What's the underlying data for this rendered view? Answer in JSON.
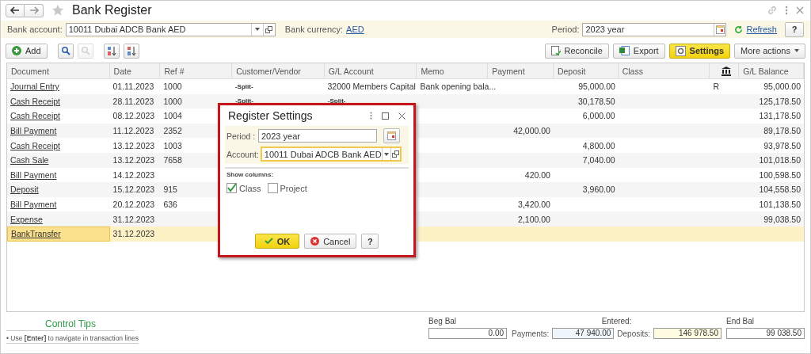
{
  "window": {
    "title": "Bank Register"
  },
  "filters": {
    "bank_account_label": "Bank account:",
    "bank_account": "10011 Dubai ADCB Bank AED",
    "currency_label": "Bank currency:",
    "currency": "AED",
    "period_label": "Period:",
    "period": "2023 year",
    "refresh": "Refresh",
    "help": "?"
  },
  "toolbar": {
    "add": "Add",
    "icon_buttons": [
      {
        "kind": "search",
        "disabled": false
      },
      {
        "kind": "cancel-search",
        "disabled": true
      },
      {
        "kind": "sort-asc",
        "disabled": false
      },
      {
        "kind": "sort-desc",
        "disabled": false
      }
    ],
    "buttons": [
      {
        "kind": "reconcile",
        "label": "Reconcile",
        "primary": false
      },
      {
        "kind": "export",
        "label": "Export",
        "primary": false
      },
      {
        "kind": "settings",
        "label": "Settings",
        "primary": true
      },
      {
        "kind": "menu",
        "label": "More actions",
        "primary": false
      }
    ]
  },
  "table": {
    "columns": [
      {
        "kind": "text",
        "label": "Document"
      },
      {
        "kind": "text",
        "label": "Date"
      },
      {
        "kind": "text",
        "label": "Ref #"
      },
      {
        "kind": "text",
        "label": "Customer/Vendor"
      },
      {
        "kind": "text",
        "label": "G/L Account"
      },
      {
        "kind": "text",
        "label": "Memo"
      },
      {
        "kind": "text",
        "label": "Payment"
      },
      {
        "kind": "text",
        "label": "Deposit"
      },
      {
        "kind": "text",
        "label": "Class"
      },
      {
        "kind": "bank"
      },
      {
        "kind": "text",
        "label": "G/L Balance"
      }
    ],
    "rows": [
      {
        "document": "Journal Entry",
        "date": "01.11.2023",
        "ref": "1000",
        "customer": "-Split-",
        "gl_account": "32000 Members Capital",
        "memo": "Bank opening bala...",
        "deposit": "95,000.00",
        "reconciled": "R",
        "balance": "95,000.00",
        "selected": false
      },
      {
        "document": "Cash Receipt",
        "date": "28.11.2023",
        "ref": "1000",
        "customer": "-Split-",
        "gl_account": "-Split-",
        "deposit": "30,178.50",
        "balance": "125,178.50",
        "selected": false
      },
      {
        "document": "Cash Receipt",
        "date": "08.12.2023",
        "ref": "1004",
        "deposit": "6,000.00",
        "balance": "131,178.50",
        "selected": false
      },
      {
        "document": "Bill Payment",
        "date": "11.12.2023",
        "ref": "2352",
        "payment": "42,000.00",
        "balance": "89,178.50",
        "selected": false
      },
      {
        "document": "Cash Receipt",
        "date": "13.12.2023",
        "ref": "1003",
        "deposit": "4,800.00",
        "balance": "93,978.50",
        "selected": false
      },
      {
        "document": "Cash Sale",
        "date": "13.12.2023",
        "ref": "7658",
        "deposit": "7,040.00",
        "balance": "101,018.50",
        "selected": false
      },
      {
        "document": "Bill Payment",
        "date": "14.12.2023",
        "payment": "420.00",
        "balance": "100,598.50",
        "selected": false
      },
      {
        "document": "Deposit",
        "date": "15.12.2023",
        "ref": "915",
        "deposit": "3,960.00",
        "balance": "104,558.50",
        "selected": false
      },
      {
        "document": "Bill Payment",
        "date": "20.12.2023",
        "ref": "636",
        "payment": "3,420.00",
        "balance": "101,138.50",
        "selected": false
      },
      {
        "document": "Expense",
        "date": "31.12.2023",
        "payment": "2,100.00",
        "balance": "99,038.50",
        "selected": false
      },
      {
        "document": "BankTransfer",
        "date": "31.12.2023",
        "selected": true
      }
    ]
  },
  "dialog": {
    "title": "Register Settings",
    "period_label": "Period :",
    "period": "2023 year",
    "account_label": "Account:",
    "account": "10011 Dubai ADCB Bank AED",
    "show_columns_label": "Show columns:",
    "columns": [
      {
        "label": "Class",
        "checked": true
      },
      {
        "label": "Project",
        "checked": false
      }
    ],
    "ok": "OK",
    "cancel": "Cancel",
    "help": "?"
  },
  "footer": {
    "tips_title": "Control Tips",
    "tip": "• Use **[Enter]** to navigate in transaction lines",
    "totals": {
      "beg_bal_label": "Beg Bal",
      "beg_bal": "0.00",
      "entered_label": "Entered:",
      "payments_label": "Payments:",
      "payments": "47 940.00",
      "deposits_label": "Deposits:",
      "deposits": "146 978.50",
      "end_bal_label": "End Bal",
      "end_bal": "99 038.50"
    }
  }
}
